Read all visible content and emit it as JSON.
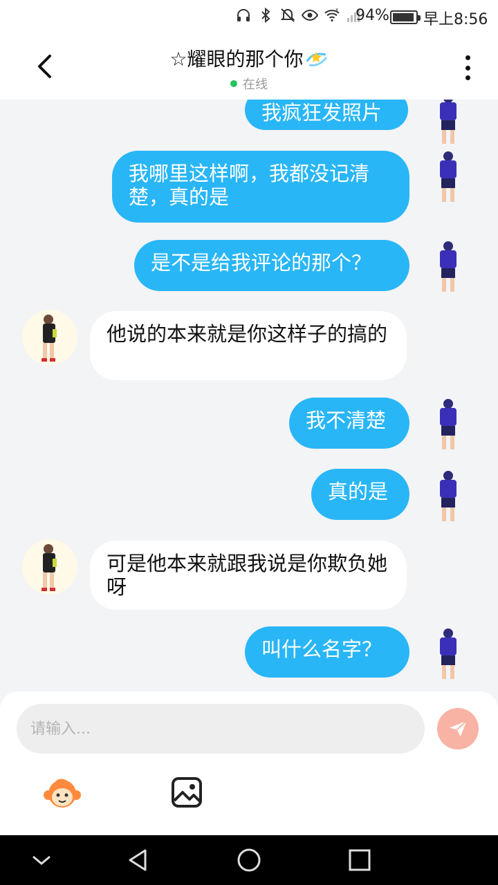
{
  "status_bar": {
    "battery": "94%",
    "time": "早上8:56",
    "icons": [
      "headphones-icon",
      "bluetooth-icon",
      "mute-icon",
      "eye-icon",
      "wifi-icon",
      "signal-icon"
    ]
  },
  "header": {
    "title": "☆耀眼的那个你",
    "title_emoji": "dizzy-star-emoji",
    "online_status": "在线",
    "online_color": "#22c55e"
  },
  "messages": [
    {
      "side": "out",
      "text": "我疯狂发照片"
    },
    {
      "side": "out",
      "text": "我哪里这样啊，我都没记清楚，真的是"
    },
    {
      "side": "out",
      "text": "是不是给我评论的那个？"
    },
    {
      "side": "in",
      "text": "他说的本来就是你这样子的搞的"
    },
    {
      "side": "out",
      "text": "我不清楚"
    },
    {
      "side": "out",
      "text": "真的是"
    },
    {
      "side": "in",
      "text": "可是他本来就跟我说是你欺负她呀"
    },
    {
      "side": "out",
      "text": "叫什么名字？"
    }
  ],
  "composer": {
    "placeholder": "请输入..."
  },
  "colors": {
    "outgoing_bubble": "#29b6f6",
    "incoming_bubble": "#ffffff",
    "send_button": "#f8b3a4"
  }
}
